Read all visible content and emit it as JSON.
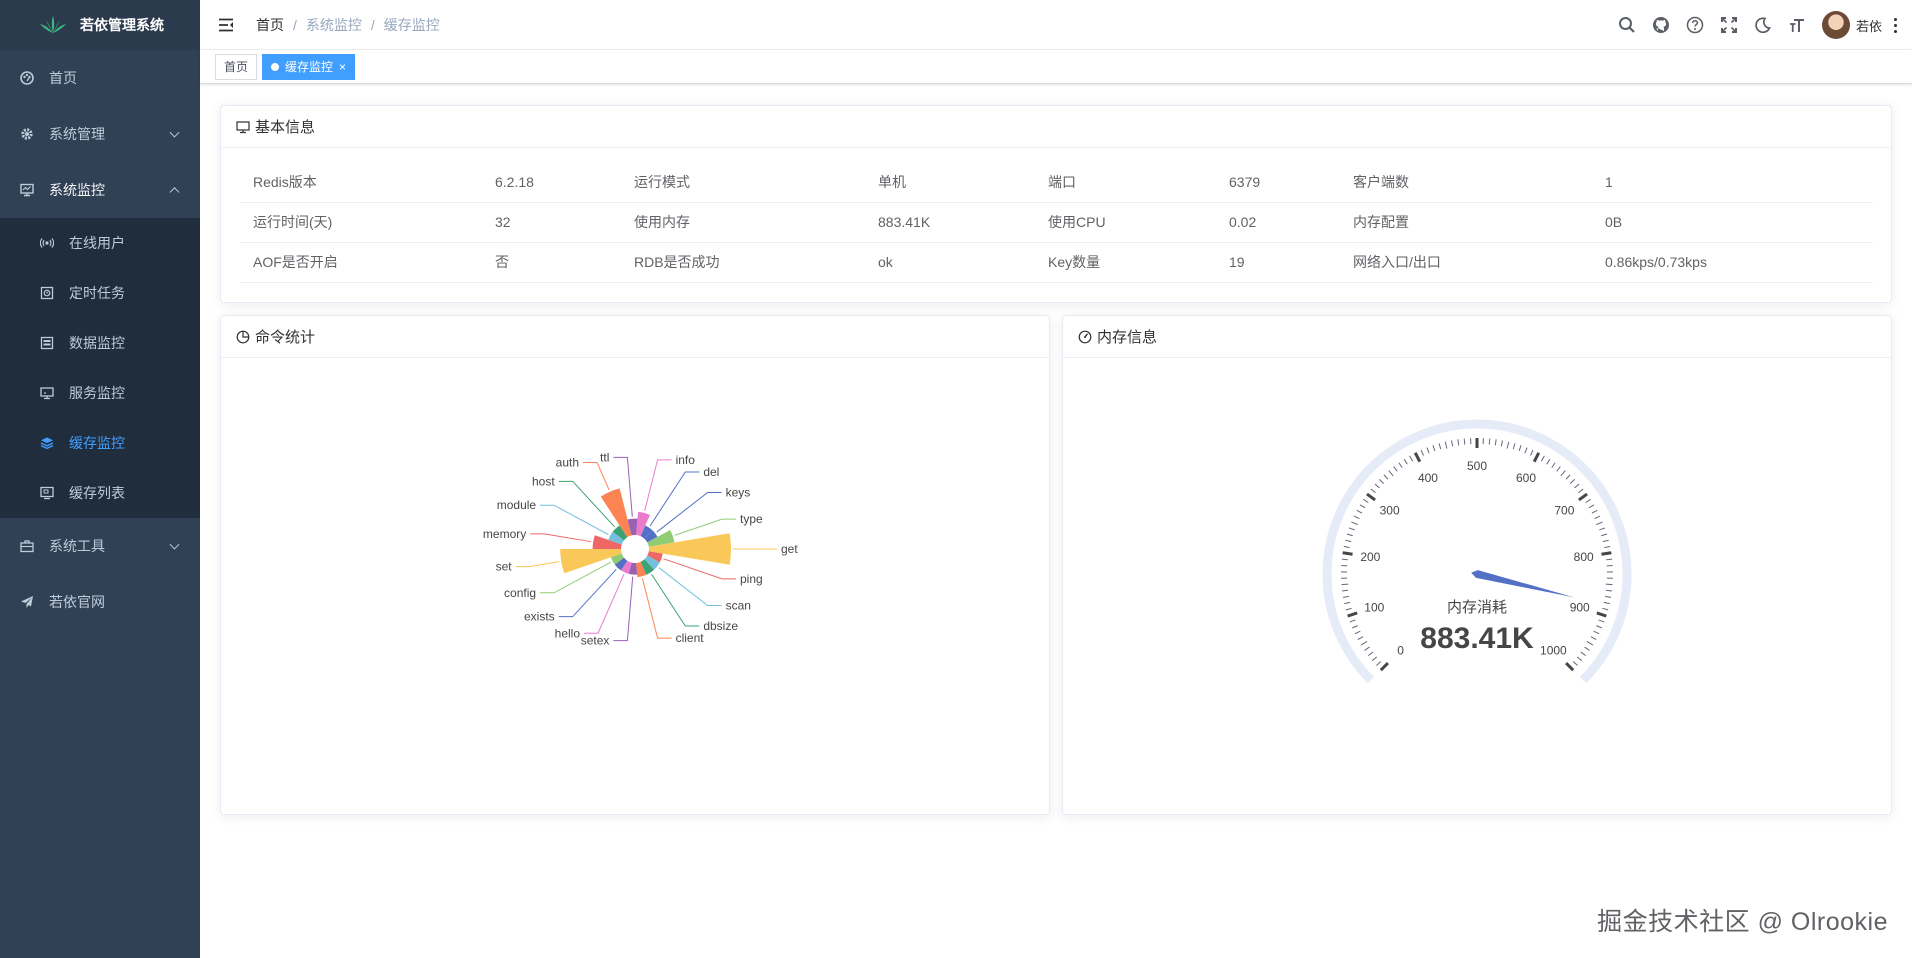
{
  "app": {
    "title": "若依管理系统"
  },
  "sidebar": {
    "items": [
      {
        "label": "首页",
        "icon": "dashboard-icon"
      },
      {
        "label": "系统管理",
        "icon": "gear-icon",
        "expandable": true
      },
      {
        "label": "系统监控",
        "icon": "monitor-icon",
        "expandable": true,
        "open": true,
        "children": [
          {
            "label": "在线用户",
            "icon": "online-icon"
          },
          {
            "label": "定时任务",
            "icon": "job-icon"
          },
          {
            "label": "数据监控",
            "icon": "druid-icon"
          },
          {
            "label": "服务监控",
            "icon": "server-icon"
          },
          {
            "label": "缓存监控",
            "icon": "redis-icon",
            "active": true
          },
          {
            "label": "缓存列表",
            "icon": "redis-list-icon"
          }
        ]
      },
      {
        "label": "系统工具",
        "icon": "tool-icon",
        "expandable": true
      },
      {
        "label": "若依官网",
        "icon": "guide-icon"
      }
    ]
  },
  "breadcrumb": [
    "首页",
    "系统监控",
    "缓存监控"
  ],
  "header": {
    "username": "若依"
  },
  "tags": [
    {
      "label": "首页",
      "active": false
    },
    {
      "label": "缓存监控",
      "active": true,
      "close": "×"
    }
  ],
  "basic_info": {
    "title": "基本信息",
    "rows": [
      [
        "Redis版本",
        "6.2.18",
        "运行模式",
        "单机",
        "端口",
        "6379",
        "客户端数",
        "1"
      ],
      [
        "运行时间(天)",
        "32",
        "使用内存",
        "883.41K",
        "使用CPU",
        "0.02",
        "内存配置",
        "0B"
      ],
      [
        "AOF是否开启",
        "否",
        "RDB是否成功",
        "ok",
        "Key数量",
        "19",
        "网络入口/出口",
        "0.86kps/0.73kps"
      ]
    ]
  },
  "command_stats": {
    "title": "命令统计"
  },
  "memory_info": {
    "title": "内存信息"
  },
  "watermark": "掘金技术社区 @ Olrookie",
  "chart_data": [
    {
      "type": "pie",
      "subtype": "rose",
      "title": "",
      "slices": [
        {
          "name": "get",
          "value": 100,
          "color": "#fac858"
        },
        {
          "name": "ping",
          "value": 3,
          "color": "#ee6666"
        },
        {
          "name": "scan",
          "value": 3,
          "color": "#73c0de"
        },
        {
          "name": "dbsize",
          "value": 3,
          "color": "#3ba272"
        },
        {
          "name": "client",
          "value": 3,
          "color": "#fc8452"
        },
        {
          "name": "setex",
          "value": 2,
          "color": "#9a60b4"
        },
        {
          "name": "hello",
          "value": 2,
          "color": "#ea7ccc"
        },
        {
          "name": "exists",
          "value": 2,
          "color": "#5470c6"
        },
        {
          "name": "config",
          "value": 2,
          "color": "#91cc75"
        },
        {
          "name": "set",
          "value": 55,
          "color": "#fac858"
        },
        {
          "name": "memory",
          "value": 12,
          "color": "#ee6666"
        },
        {
          "name": "module",
          "value": 3,
          "color": "#73c0de"
        },
        {
          "name": "host",
          "value": 3,
          "color": "#3ba272"
        },
        {
          "name": "auth",
          "value": 35,
          "color": "#fc8452"
        },
        {
          "name": "ttl",
          "value": 4,
          "color": "#9a60b4"
        },
        {
          "name": "info",
          "value": 8,
          "color": "#ea7ccc"
        },
        {
          "name": "del",
          "value": 2,
          "color": "#5470c6"
        },
        {
          "name": "keys",
          "value": 2,
          "color": "#5470c6"
        },
        {
          "name": "type",
          "value": 10,
          "color": "#91cc75"
        }
      ]
    },
    {
      "type": "gauge",
      "title": "",
      "name": "内存消耗",
      "value": 883.41,
      "value_label": "883.41K",
      "min": 0,
      "max": 1000,
      "ticks": [
        "0",
        "100",
        "200",
        "300",
        "400",
        "500",
        "600",
        "700",
        "800",
        "900",
        "1000"
      ],
      "pointer_color": "#5470c6",
      "track_color": "#e6ebf8"
    }
  ]
}
